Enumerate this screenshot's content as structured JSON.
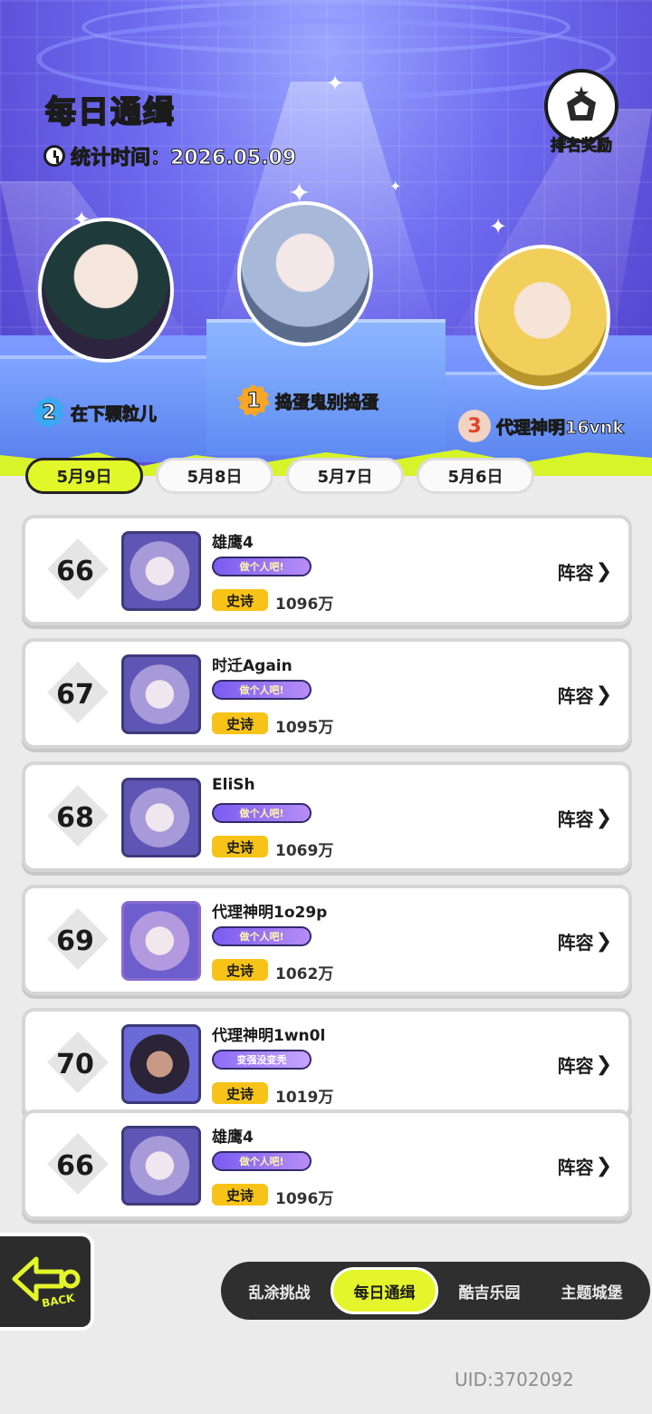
{
  "header": {
    "title": "每日通缉",
    "stat_time": "统计时间：2026.05.09",
    "reward_label": "排名奖励"
  },
  "podium": [
    {
      "rank": "2",
      "name": "在下颗粒儿"
    },
    {
      "rank": "1",
      "name": "捣蛋鬼别捣蛋"
    },
    {
      "rank": "3",
      "name": "代理神明16vnk"
    }
  ],
  "date_tabs": [
    "5月9日",
    "5月8日",
    "5月7日",
    "5月6日"
  ],
  "active_date": "5月9日",
  "rows": [
    {
      "rank": "66",
      "name": "雄鹰4",
      "title": "做个人吧!",
      "tier": "史诗",
      "score": "1096万",
      "action": "阵容"
    },
    {
      "rank": "67",
      "name": "时迁Again",
      "title": "做个人吧!",
      "tier": "史诗",
      "score": "1095万",
      "action": "阵容"
    },
    {
      "rank": "68",
      "name": "EliSh",
      "title": "做个人吧!",
      "tier": "史诗",
      "score": "1069万",
      "action": "阵容"
    },
    {
      "rank": "69",
      "name": "代理神明1o29p",
      "title": "做个人吧!",
      "tier": "史诗",
      "score": "1062万",
      "action": "阵容"
    },
    {
      "rank": "70",
      "name": "代理神明1wn0l",
      "title": "变强没变秃",
      "tier": "史诗",
      "score": "1019万",
      "action": "阵容"
    },
    {
      "rank": "66",
      "name": "雄鹰4",
      "title": "做个人吧!",
      "tier": "史诗",
      "score": "1096万",
      "action": "阵容"
    }
  ],
  "back_label": "BACK",
  "nav": [
    "乱涂挑战",
    "每日通缉",
    "酷吉乐园",
    "主题城堡"
  ],
  "active_nav": "每日通缉",
  "uid": "UID:3702092",
  "colors": {
    "accent": "#e4f52b",
    "tier": "#f7c318",
    "stage": "#6f6cf0"
  }
}
